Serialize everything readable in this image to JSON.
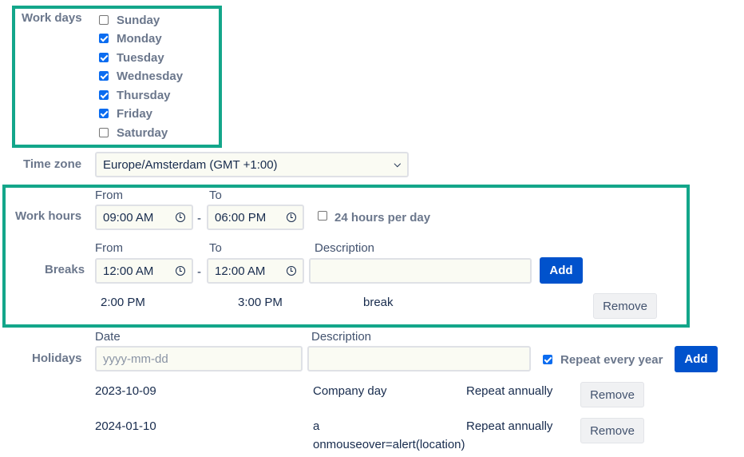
{
  "work_days": {
    "label": "Work days",
    "days": [
      {
        "label": "Sunday",
        "checked": false
      },
      {
        "label": "Monday",
        "checked": true
      },
      {
        "label": "Tuesday",
        "checked": true
      },
      {
        "label": "Wednesday",
        "checked": true
      },
      {
        "label": "Thursday",
        "checked": true
      },
      {
        "label": "Friday",
        "checked": true
      },
      {
        "label": "Saturday",
        "checked": false
      }
    ]
  },
  "time_zone": {
    "label": "Time zone",
    "value": "Europe/Amsterdam (GMT +1:00)"
  },
  "work_hours": {
    "label": "Work hours",
    "from_label": "From",
    "to_label": "To",
    "from": "09:00 AM",
    "to": "06:00 PM",
    "separator": "-",
    "all_day_label": "24 hours per day"
  },
  "breaks": {
    "label": "Breaks",
    "from_label": "From",
    "to_label": "To",
    "description_label": "Description",
    "from": "12:00 AM",
    "to": "12:00 AM",
    "separator": "-",
    "description": "",
    "add_label": "Add",
    "items": [
      {
        "from": "2:00 PM",
        "to": "3:00 PM",
        "description": "break",
        "remove_label": "Remove"
      }
    ]
  },
  "holidays": {
    "label": "Holidays",
    "date_label": "Date",
    "description_label": "Description",
    "date_placeholder": "yyyy-mm-dd",
    "repeat_label": "Repeat every year",
    "add_label": "Add",
    "items": [
      {
        "date": "2023-10-09",
        "description": "Company day",
        "description2": "",
        "repeat": "Repeat annually",
        "remove_label": "Remove"
      },
      {
        "date": "2024-01-10",
        "description": "a",
        "description2": "onmouseover=alert(location)",
        "repeat": "Repeat annually",
        "remove_label": "Remove"
      }
    ]
  },
  "colors": {
    "highlight": "#13a68a",
    "primary": "#0052cc"
  }
}
